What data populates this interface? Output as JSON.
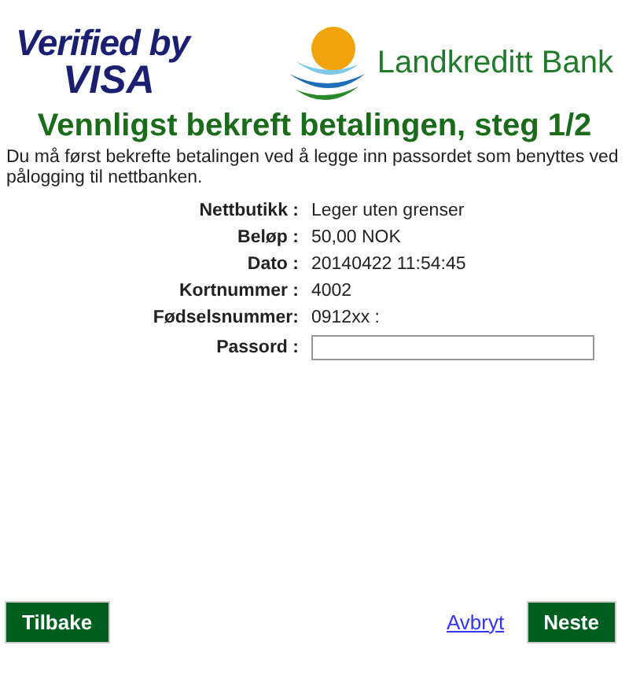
{
  "logos": {
    "visa_line_1": "Verified by",
    "visa_line_2": "VISA",
    "bank_name": "Landkreditt Bank"
  },
  "heading": "Vennligst bekreft betalingen, steg 1/2",
  "intro": "Du må først bekrefte betalingen ved å legge inn passordet som benyttes ved pålogging til nettbanken.",
  "details": [
    {
      "label": "Nettbutikk :",
      "value": "Leger uten grenser"
    },
    {
      "label": "Beløp :",
      "value": "50,00 NOK"
    },
    {
      "label": "Dato :",
      "value": "20140422 11:54:45"
    },
    {
      "label": "Kortnummer :",
      "value": "4002"
    },
    {
      "label": "Fødselsnummer:",
      "value": "0912xx :"
    }
  ],
  "password": {
    "label": "Passord :"
  },
  "buttons": {
    "back": "Tilbake",
    "cancel": "Avbryt",
    "next": "Neste"
  }
}
